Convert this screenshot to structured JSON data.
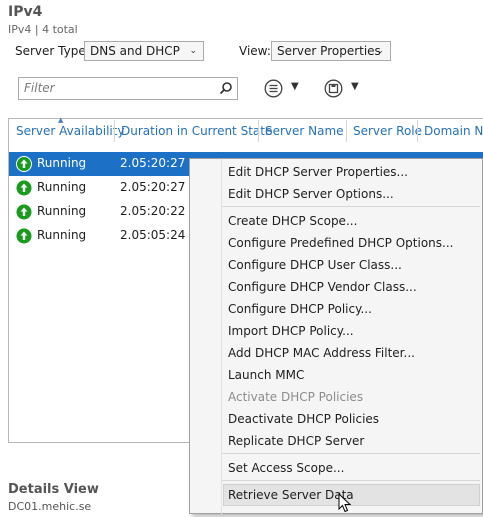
{
  "header": {
    "title": "IPv4",
    "subtitle": "IPv4 | 4 total"
  },
  "toolbar": {
    "server_type_label": "Server Type:",
    "server_type_value": "DNS and DHCP",
    "view_label": "View:",
    "view_value": "Server Properties",
    "filter_placeholder": "Filter"
  },
  "table": {
    "columns": [
      "Server Availability",
      "Duration in Current State",
      "Server Name",
      "Server Role",
      "Domain Na"
    ],
    "rows": [
      {
        "status": "Running",
        "duration": "2.05:20:27",
        "selected": true
      },
      {
        "status": "Running",
        "duration": "2.05:20:27",
        "selected": false
      },
      {
        "status": "Running",
        "duration": "2.05:20:22",
        "selected": false
      },
      {
        "status": "Running",
        "duration": "2.05:05:24",
        "selected": false
      }
    ]
  },
  "context_menu": {
    "items": [
      {
        "label": "Edit DHCP Server Properties...",
        "enabled": true
      },
      {
        "label": "Edit DHCP Server Options...",
        "enabled": true
      },
      {
        "label": "Create DHCP Scope...",
        "enabled": true
      },
      {
        "label": "Configure Predefined DHCP Options...",
        "enabled": true
      },
      {
        "label": "Configure DHCP User Class...",
        "enabled": true
      },
      {
        "label": "Configure DHCP Vendor Class...",
        "enabled": true
      },
      {
        "label": "Configure DHCP Policy...",
        "enabled": true
      },
      {
        "label": "Import DHCP Policy...",
        "enabled": true
      },
      {
        "label": "Add DHCP MAC Address Filter...",
        "enabled": true
      },
      {
        "label": "Launch MMC",
        "enabled": true
      },
      {
        "label": "Activate DHCP Policies",
        "enabled": false
      },
      {
        "label": "Deactivate DHCP Policies",
        "enabled": true
      },
      {
        "label": "Replicate DHCP Server",
        "enabled": true
      },
      {
        "label": "Set Access Scope...",
        "enabled": true
      },
      {
        "label": "Retrieve Server Data",
        "enabled": true,
        "hovered": true
      }
    ]
  },
  "details": {
    "title": "Details View",
    "subtitle": "DC01.mehic.se"
  },
  "colors": {
    "selection": "#1c71c6",
    "header_text": "#2670b8",
    "status_ok": "#1a9a1a"
  },
  "icons": {
    "status": "up-arrow-icon",
    "search": "search-icon",
    "list_tasks": "list-icon",
    "save": "save-icon"
  }
}
